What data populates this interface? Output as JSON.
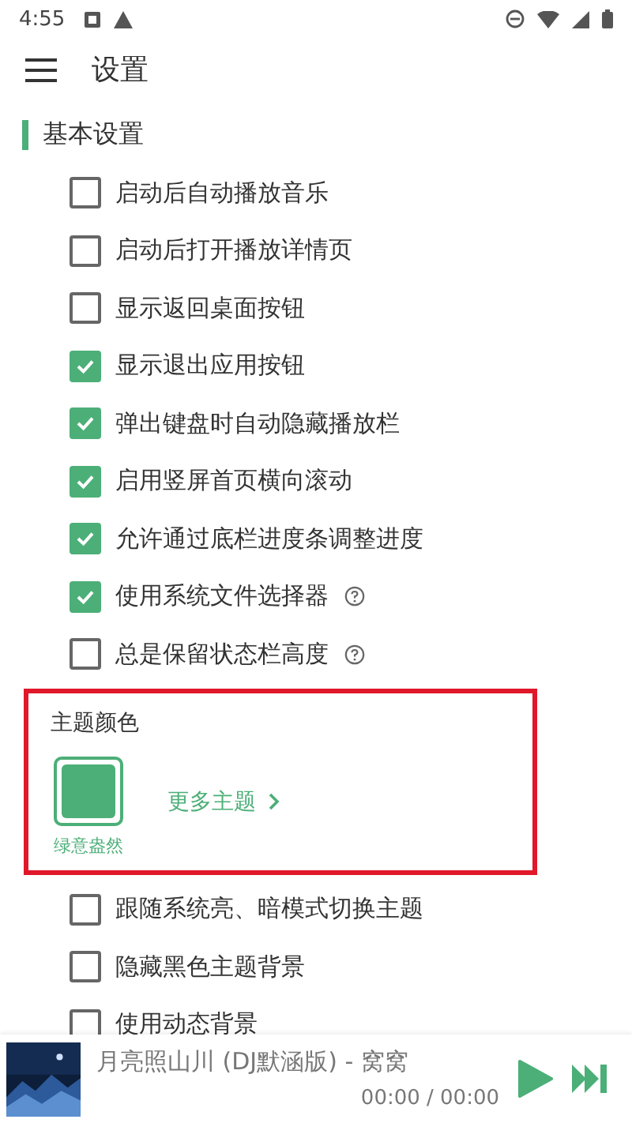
{
  "status_bar": {
    "time": "4:55"
  },
  "app_bar": {
    "title": "设置"
  },
  "section": {
    "title": "基本设置"
  },
  "options": [
    {
      "label": "启动后自动播放音乐",
      "checked": false,
      "help": false
    },
    {
      "label": "启动后打开播放详情页",
      "checked": false,
      "help": false
    },
    {
      "label": "显示返回桌面按钮",
      "checked": false,
      "help": false
    },
    {
      "label": "显示退出应用按钮",
      "checked": true,
      "help": false
    },
    {
      "label": "弹出键盘时自动隐藏播放栏",
      "checked": true,
      "help": false
    },
    {
      "label": "启用竖屏首页横向滚动",
      "checked": true,
      "help": false
    },
    {
      "label": "允许通过底栏进度条调整进度",
      "checked": true,
      "help": false
    },
    {
      "label": "使用系统文件选择器",
      "checked": true,
      "help": true
    },
    {
      "label": "总是保留状态栏高度",
      "checked": false,
      "help": true
    }
  ],
  "theme": {
    "title": "主题颜色",
    "themes": [
      {
        "name": "绿意盎然",
        "color": "#4caf78",
        "selected": true
      }
    ],
    "more": "更多主题"
  },
  "theme_options": [
    {
      "label": "跟随系统亮、暗模式切换主题",
      "checked": false
    },
    {
      "label": "隐藏黑色主题背景",
      "checked": false
    },
    {
      "label": "使用动态背景",
      "checked": false
    }
  ],
  "player": {
    "title": "月亮照山川 (DJ默涵版) - 窝窝",
    "time": "00:00 / 00:00"
  }
}
